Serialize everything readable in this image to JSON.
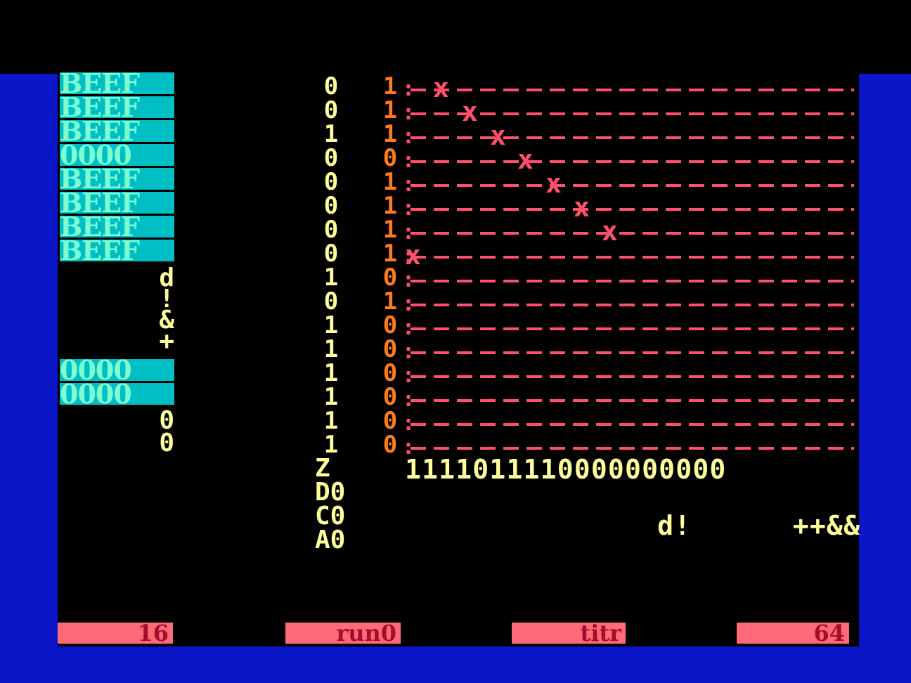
{
  "registers": {
    "top": [
      "BEEF",
      "BEEF",
      "BEEF",
      "0000",
      "BEEF",
      "BEEF",
      "BEEF",
      "BEEF"
    ],
    "mid_symbols": [
      "d",
      "!",
      "&",
      "+"
    ],
    "bottom": [
      "0000",
      "0000"
    ],
    "tail": [
      "0",
      "0"
    ]
  },
  "bit_columns": {
    "yellow": [
      "0",
      "0",
      "1",
      "0",
      "0",
      "0",
      "0",
      "0",
      "1",
      "0",
      "1",
      "1",
      "1",
      "1",
      "1",
      "1"
    ],
    "orange": [
      "1",
      "1",
      "1",
      "0",
      "1",
      "1",
      "1",
      "1",
      "0",
      "1",
      "0",
      "0",
      "0",
      "0",
      "0",
      "0"
    ]
  },
  "flags": [
    "Z",
    "D0",
    "C0",
    "A0"
  ],
  "grid_bits": "1111011110000000000",
  "grid_marks": "d!      ++&&",
  "x_marks_rows": [
    0,
    1,
    2,
    3,
    4,
    5,
    6,
    7
  ],
  "status_bar": {
    "left": "16",
    "run": "run0",
    "mode": "titr",
    "right": "64"
  },
  "colors": {
    "border": "#0a16c8",
    "register_bg": "#00bfc4",
    "register_text": "#7dffd0",
    "yellow": "#ffff9a",
    "orange": "#ff7a1a",
    "grid": "#ff4f6a",
    "status_bg": "#ff6a78"
  }
}
